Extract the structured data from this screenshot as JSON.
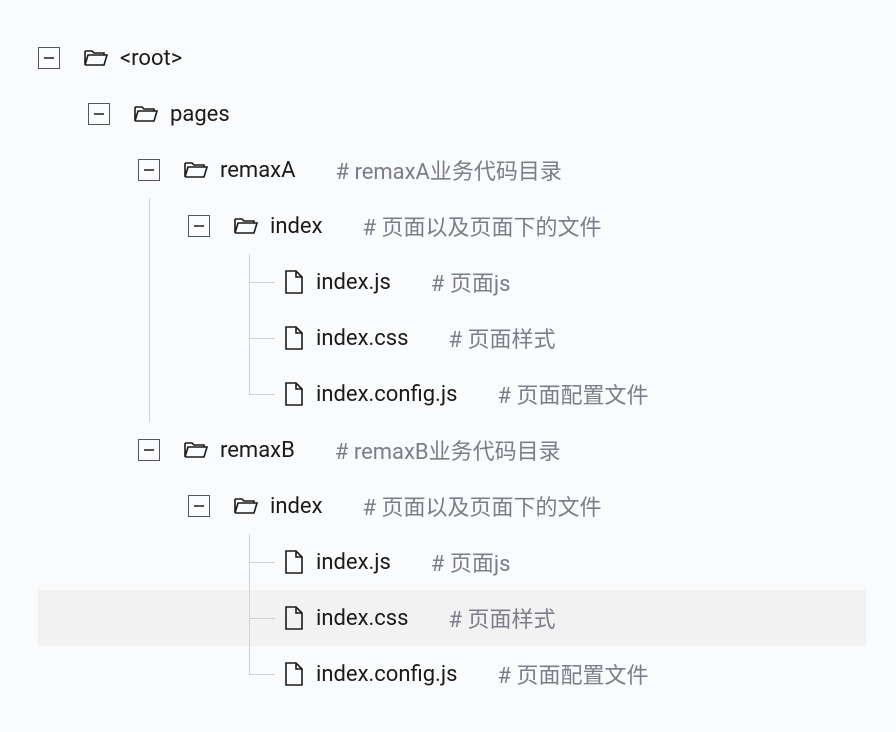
{
  "tree": {
    "root": {
      "label": "<root>"
    },
    "pages": {
      "label": "pages"
    },
    "remaxA": {
      "label": "remaxA",
      "comment": "# remaxA业务代码目录"
    },
    "remaxA_index": {
      "label": "index",
      "comment": "# 页面以及页面下的文件"
    },
    "remaxA_index_js": {
      "label": "index.js",
      "comment": "# 页面js"
    },
    "remaxA_index_css": {
      "label": "index.css",
      "comment": "# 页面样式"
    },
    "remaxA_index_config": {
      "label": "index.config.js",
      "comment": "# 页面配置文件"
    },
    "remaxB": {
      "label": "remaxB",
      "comment": "# remaxB业务代码目录"
    },
    "remaxB_index": {
      "label": "index",
      "comment": "# 页面以及页面下的文件"
    },
    "remaxB_index_js": {
      "label": "index.js",
      "comment": "# 页面js"
    },
    "remaxB_index_css": {
      "label": "index.css",
      "comment": "# 页面样式"
    },
    "remaxB_index_config": {
      "label": "index.config.js",
      "comment": "# 页面配置文件"
    }
  }
}
